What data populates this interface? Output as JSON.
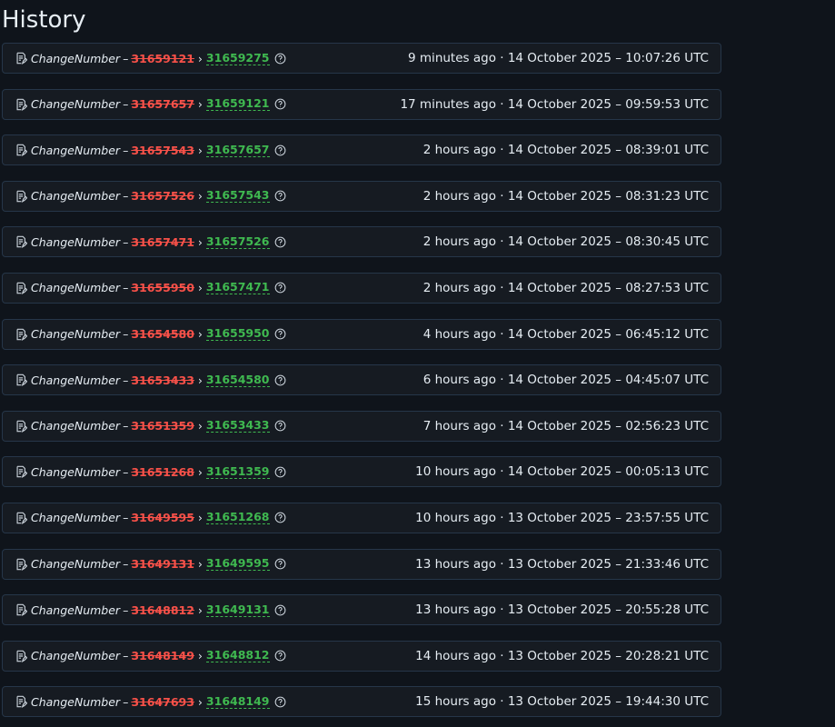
{
  "page": {
    "title": "History"
  },
  "icons": {
    "entry": "document-edit-icon",
    "help": "question-circle-icon"
  },
  "colors": {
    "removed": "#f85149",
    "added": "#3fb950",
    "border": "#263649",
    "row_bg": "#161b22",
    "page_bg": "#0f141b"
  },
  "entries": [
    {
      "key": "ChangeNumber",
      "dash": "–",
      "arrow": "›",
      "old": "31659121",
      "new": "31659275",
      "time": "9 minutes ago · 14 October 2025 – 10:07:26 UTC"
    },
    {
      "key": "ChangeNumber",
      "dash": "–",
      "arrow": "›",
      "old": "31657657",
      "new": "31659121",
      "time": "17 minutes ago · 14 October 2025 – 09:59:53 UTC"
    },
    {
      "key": "ChangeNumber",
      "dash": "–",
      "arrow": "›",
      "old": "31657543",
      "new": "31657657",
      "time": "2 hours ago · 14 October 2025 – 08:39:01 UTC"
    },
    {
      "key": "ChangeNumber",
      "dash": "–",
      "arrow": "›",
      "old": "31657526",
      "new": "31657543",
      "time": "2 hours ago · 14 October 2025 – 08:31:23 UTC"
    },
    {
      "key": "ChangeNumber",
      "dash": "–",
      "arrow": "›",
      "old": "31657471",
      "new": "31657526",
      "time": "2 hours ago · 14 October 2025 – 08:30:45 UTC"
    },
    {
      "key": "ChangeNumber",
      "dash": "–",
      "arrow": "›",
      "old": "31655950",
      "new": "31657471",
      "time": "2 hours ago · 14 October 2025 – 08:27:53 UTC"
    },
    {
      "key": "ChangeNumber",
      "dash": "–",
      "arrow": "›",
      "old": "31654580",
      "new": "31655950",
      "time": "4 hours ago · 14 October 2025 – 06:45:12 UTC"
    },
    {
      "key": "ChangeNumber",
      "dash": "–",
      "arrow": "›",
      "old": "31653433",
      "new": "31654580",
      "time": "6 hours ago · 14 October 2025 – 04:45:07 UTC"
    },
    {
      "key": "ChangeNumber",
      "dash": "–",
      "arrow": "›",
      "old": "31651359",
      "new": "31653433",
      "time": "7 hours ago · 14 October 2025 – 02:56:23 UTC"
    },
    {
      "key": "ChangeNumber",
      "dash": "–",
      "arrow": "›",
      "old": "31651268",
      "new": "31651359",
      "time": "10 hours ago · 14 October 2025 – 00:05:13 UTC"
    },
    {
      "key": "ChangeNumber",
      "dash": "–",
      "arrow": "›",
      "old": "31649595",
      "new": "31651268",
      "time": "10 hours ago · 13 October 2025 – 23:57:55 UTC"
    },
    {
      "key": "ChangeNumber",
      "dash": "–",
      "arrow": "›",
      "old": "31649131",
      "new": "31649595",
      "time": "13 hours ago · 13 October 2025 – 21:33:46 UTC"
    },
    {
      "key": "ChangeNumber",
      "dash": "–",
      "arrow": "›",
      "old": "31648812",
      "new": "31649131",
      "time": "13 hours ago · 13 October 2025 – 20:55:28 UTC"
    },
    {
      "key": "ChangeNumber",
      "dash": "–",
      "arrow": "›",
      "old": "31648149",
      "new": "31648812",
      "time": "14 hours ago · 13 October 2025 – 20:28:21 UTC"
    },
    {
      "key": "ChangeNumber",
      "dash": "–",
      "arrow": "›",
      "old": "31647693",
      "new": "31648149",
      "time": "15 hours ago · 13 October 2025 – 19:44:30 UTC"
    }
  ]
}
